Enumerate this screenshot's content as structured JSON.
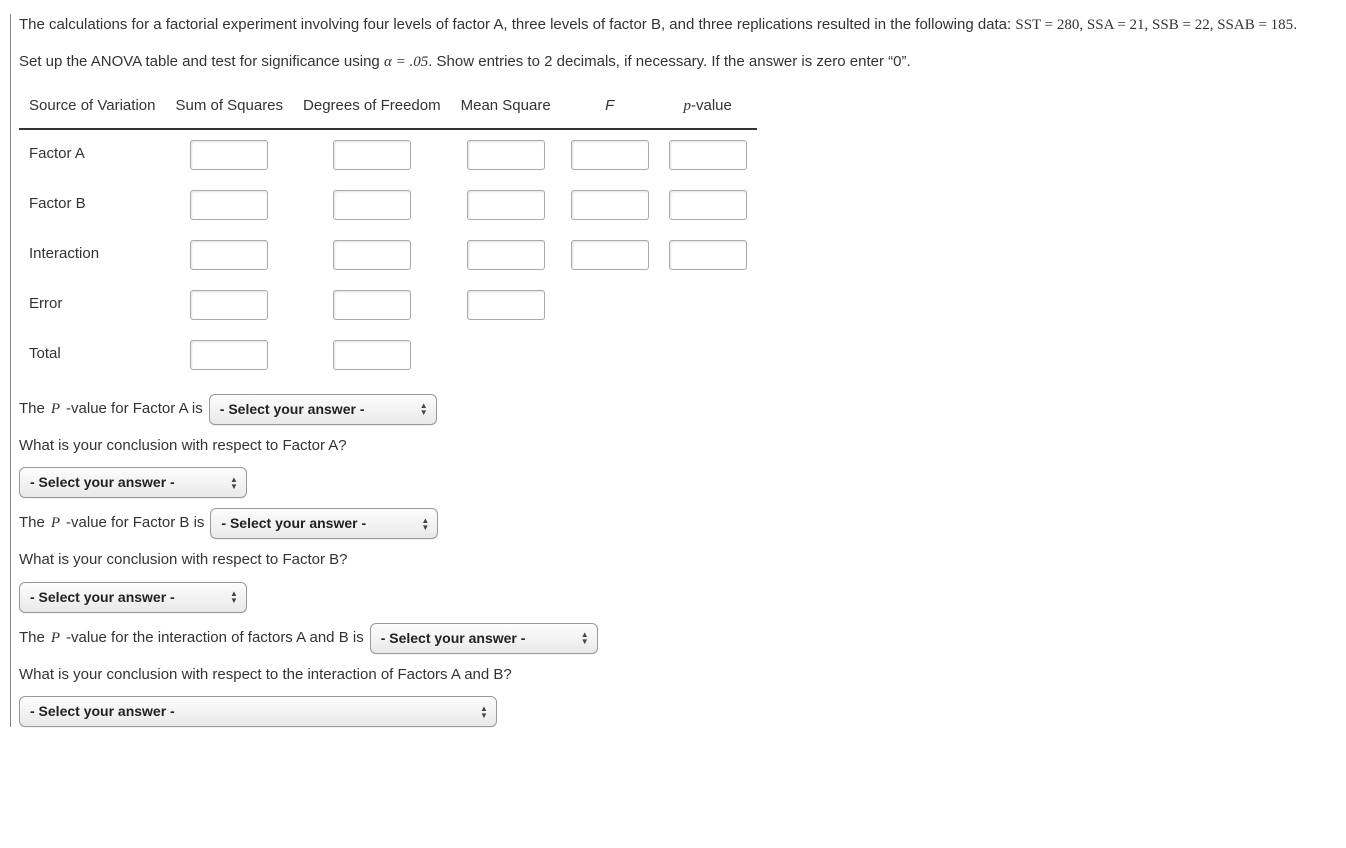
{
  "intro": {
    "line1_pre": "The calculations for a factorial experiment involving four levels of factor A, three levels of factor B, and three replications resulted in the following data: ",
    "eq": "SST = 280, SSA = 21, SSB = 22, SSAB = 185",
    "line1_post": ".",
    "line2_pre": "Set up the ANOVA table and test for significance using ",
    "alpha_expr": "α = .05",
    "line2_post": ". Show entries to 2 decimals, if necessary. If the answer is zero enter “0”."
  },
  "table": {
    "headers": {
      "source": "Source of Variation",
      "ss": "Sum of Squares",
      "df": "Degrees of Freedom",
      "ms": "Mean Square",
      "f": "F",
      "p": "p-value"
    },
    "rows": {
      "a": "Factor A",
      "b": "Factor B",
      "int": "Interaction",
      "err": "Error",
      "tot": "Total"
    }
  },
  "questions": {
    "pA_pre": "The ",
    "pA_mid": "-value for Factor A is",
    "concA": "What is your conclusion with respect to Factor A?",
    "pB_pre": "The ",
    "pB_mid": "-value for Factor B is",
    "concB": "What is your conclusion with respect to Factor B?",
    "pInt_pre": "The ",
    "pInt_mid": "-value for the interaction of factors A and B is",
    "concInt": "What is your conclusion with respect to the interaction of Factors A and B?",
    "p_letter": "p",
    "p_letter_cap": "P"
  },
  "select_placeholder": "- Select your answer -"
}
